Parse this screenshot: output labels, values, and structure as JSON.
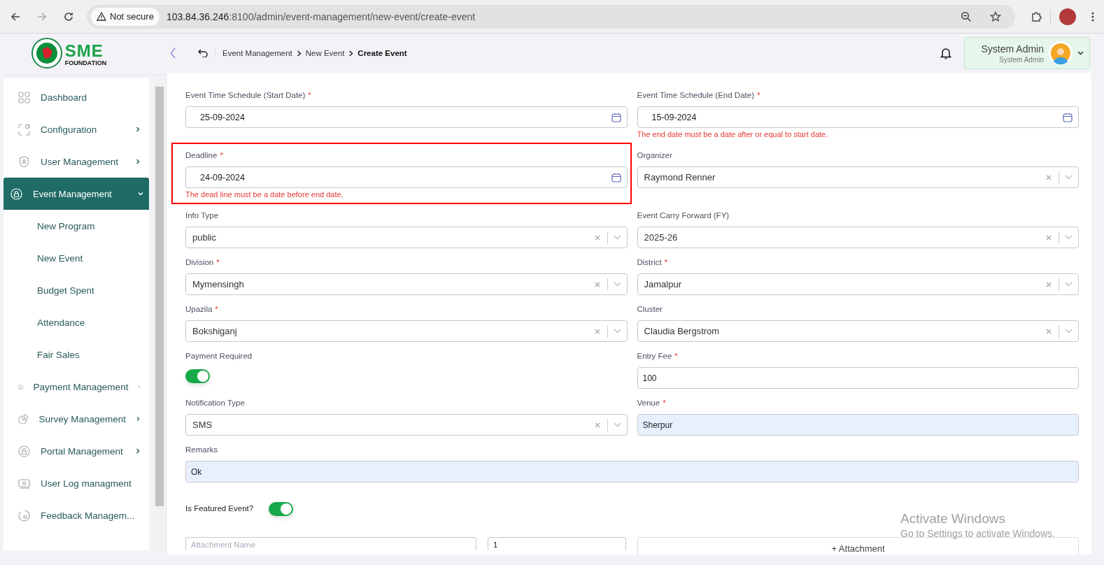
{
  "browser": {
    "security_label": "Not secure",
    "url_host": "103.84.36.246",
    "url_path": ":8100/admin/event-management/new-event/create-event"
  },
  "sidebar": {
    "logo": {
      "mark": "SME",
      "caption": "FOUNDATION"
    },
    "items": [
      {
        "label": "Dashboard",
        "has_submenu": false,
        "selected": false
      },
      {
        "label": "Configuration",
        "has_submenu": true,
        "selected": false,
        "expanded": false
      },
      {
        "label": "User Management",
        "has_submenu": true,
        "selected": false,
        "expanded": false
      },
      {
        "label": "Event Management",
        "has_submenu": true,
        "selected": true,
        "expanded": true,
        "children": [
          {
            "label": "New Program"
          },
          {
            "label": "New Event"
          },
          {
            "label": "Budget Spent"
          },
          {
            "label": "Attendance"
          },
          {
            "label": "Fair Sales"
          }
        ]
      },
      {
        "label": "Payment Management",
        "has_submenu": true,
        "selected": false,
        "expanded": false
      },
      {
        "label": "Survey Management",
        "has_submenu": true,
        "selected": false,
        "expanded": false
      },
      {
        "label": "Portal Management",
        "has_submenu": true,
        "selected": false,
        "expanded": false
      },
      {
        "label": "User Log managment",
        "has_submenu": false,
        "selected": false
      },
      {
        "label": "Feedback Managem...",
        "has_submenu": false,
        "selected": false
      }
    ]
  },
  "header": {
    "breadcrumb": [
      {
        "label": "Event Management",
        "current": false
      },
      {
        "label": "New Event",
        "current": false
      },
      {
        "label": "Create Event",
        "current": true
      }
    ],
    "user": {
      "name": "System Admin",
      "role": "System Admin"
    }
  },
  "form": {
    "rows": [
      [
        {
          "kind": "date",
          "label": "Event Time Schedule (Start Date)",
          "required_mark": "*",
          "value": "25-09-2024"
        },
        {
          "kind": "date",
          "label": "Event Time Schedule (End Date)",
          "required_mark": "*",
          "value": "15-09-2024",
          "error": "The end date must be a date after or equal to start date."
        }
      ],
      [
        {
          "kind": "date",
          "label": "Deadline",
          "required_mark": "*",
          "value": "24-09-2024",
          "error": "The dead line must be a date before end date.",
          "highlighted": true
        },
        {
          "kind": "select",
          "label": "Organizer",
          "value": "Raymond Renner"
        }
      ],
      [
        {
          "kind": "select",
          "label": "Info Type",
          "value": "public"
        },
        {
          "kind": "select",
          "label": "Event Carry Forward (FY)",
          "value": "2025-26"
        }
      ],
      [
        {
          "kind": "select",
          "label": "Division",
          "required_mark": "*",
          "value": "Mymensingh"
        },
        {
          "kind": "select",
          "label": "District",
          "required_mark": "*",
          "value": "Jamalpur"
        }
      ],
      [
        {
          "kind": "select",
          "label": "Upazila",
          "required_mark": "*",
          "value": "Bokshiganj"
        },
        {
          "kind": "select",
          "label": "Cluster",
          "value": "Claudia Bergstrom"
        }
      ],
      [
        {
          "kind": "toggle",
          "label": "Payment Required",
          "on": true
        },
        {
          "kind": "text",
          "label": "Entry Fee",
          "required_mark": "*",
          "value": "100",
          "autofilled": false
        }
      ],
      [
        {
          "kind": "select",
          "label": "Notification Type",
          "value": "SMS"
        },
        {
          "kind": "text",
          "label": "Venue",
          "required_mark": "*",
          "value": "Sherpur",
          "autofilled": true
        }
      ],
      [
        {
          "kind": "text",
          "label": "Remarks",
          "value": "Ok",
          "autofilled": true
        }
      ],
      [
        {
          "kind": "toggle_inline",
          "label": "Is Featured Event?",
          "on": true
        }
      ]
    ]
  },
  "attachment_row": {
    "name_placeholder": "Attachment Name",
    "count": "1",
    "button": "+ Attachment"
  },
  "os_notice": {
    "title": "Activate Windows",
    "text": "Go to Settings to activate Windows."
  }
}
